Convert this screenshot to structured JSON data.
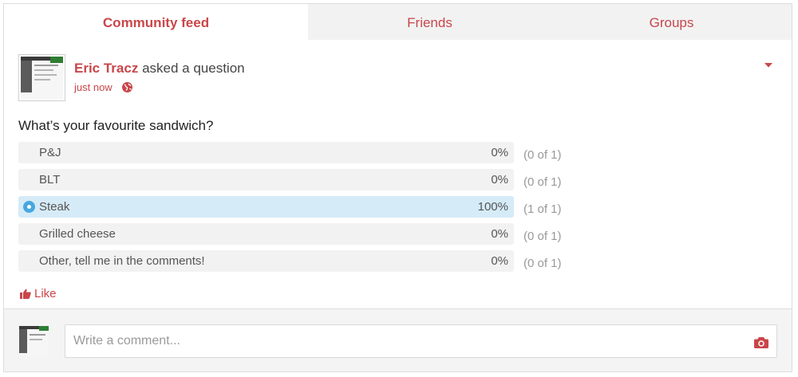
{
  "tabs": [
    {
      "label": "Community feed",
      "active": true
    },
    {
      "label": "Friends",
      "active": false
    },
    {
      "label": "Groups",
      "active": false
    }
  ],
  "post": {
    "author": "Eric Tracz",
    "action": "asked a question",
    "time": "just now",
    "visibility_icon": "globe-icon",
    "menu_icon": "caret-down-icon",
    "question": "What’s your favourite sandwich?",
    "options": [
      {
        "label": "P&J",
        "percent": "0%",
        "count": "(0 of 1)",
        "selected": false
      },
      {
        "label": "BLT",
        "percent": "0%",
        "count": "(0 of 1)",
        "selected": false
      },
      {
        "label": "Steak",
        "percent": "100%",
        "count": "(1 of 1)",
        "selected": true
      },
      {
        "label": "Grilled cheese",
        "percent": "0%",
        "count": "(0 of 1)",
        "selected": false
      },
      {
        "label": "Other, tell me in the comments!",
        "percent": "0%",
        "count": "(0 of 1)",
        "selected": false
      }
    ],
    "like_label": "Like"
  },
  "comment": {
    "placeholder": "Write a comment...",
    "value": "",
    "camera_icon": "camera-icon"
  },
  "colors": {
    "accent": "#c9464a",
    "selected_option_bg": "#d6ebf8",
    "option_bg": "#f2f2f2",
    "radio": "#48a7e0"
  }
}
